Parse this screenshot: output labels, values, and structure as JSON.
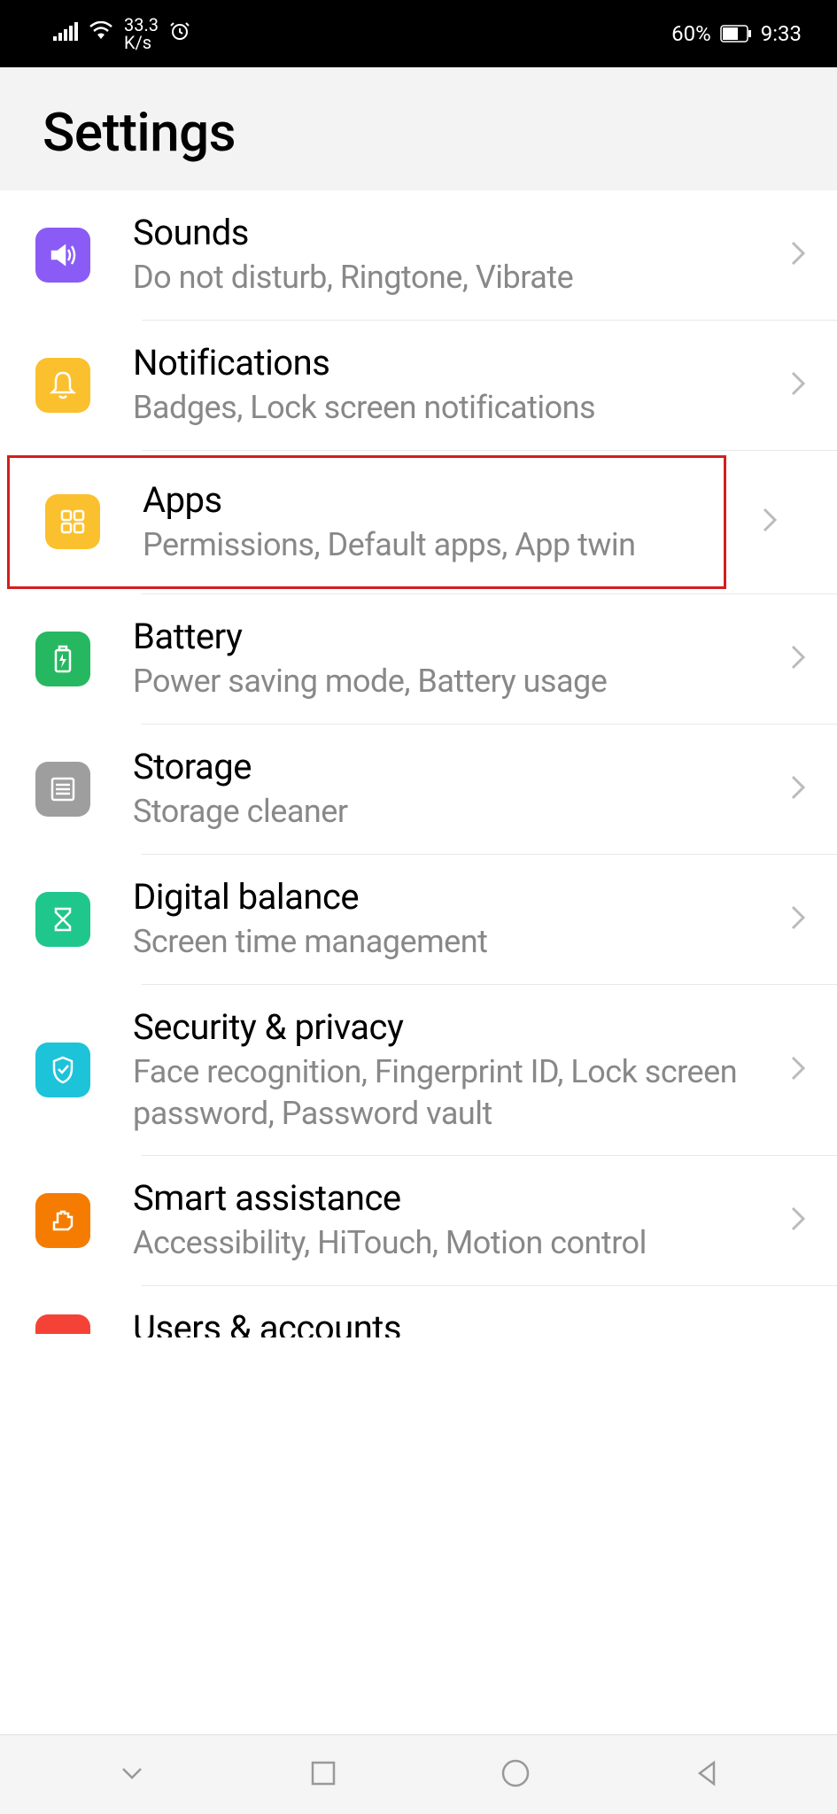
{
  "status_bar": {
    "speed": "33.3",
    "speed_unit": "K/s",
    "battery_percent": "60%",
    "time": "9:33"
  },
  "header": {
    "title": "Settings"
  },
  "items": [
    {
      "title": "Sounds",
      "subtitle": "Do not disturb, Ringtone, Vibrate",
      "icon_color": "#8a5cf5"
    },
    {
      "title": "Notifications",
      "subtitle": "Badges, Lock screen notifications",
      "icon_color": "#fbc02d"
    },
    {
      "title": "Apps",
      "subtitle": "Permissions, Default apps, App twin",
      "icon_color": "#fbc02d",
      "highlighted": true
    },
    {
      "title": "Battery",
      "subtitle": "Power saving mode, Battery usage",
      "icon_color": "#26b860"
    },
    {
      "title": "Storage",
      "subtitle": "Storage cleaner",
      "icon_color": "#9e9e9e"
    },
    {
      "title": "Digital balance",
      "subtitle": "Screen time management",
      "icon_color": "#1fc78c"
    },
    {
      "title": "Security & privacy",
      "subtitle": "Face recognition, Fingerprint ID, Lock screen password, Password vault",
      "icon_color": "#1dc3d8"
    },
    {
      "title": "Smart assistance",
      "subtitle": "Accessibility, HiTouch, Motion control",
      "icon_color": "#f57c00"
    },
    {
      "title": "Users & accounts",
      "subtitle": "",
      "icon_color": "#f44336"
    }
  ]
}
